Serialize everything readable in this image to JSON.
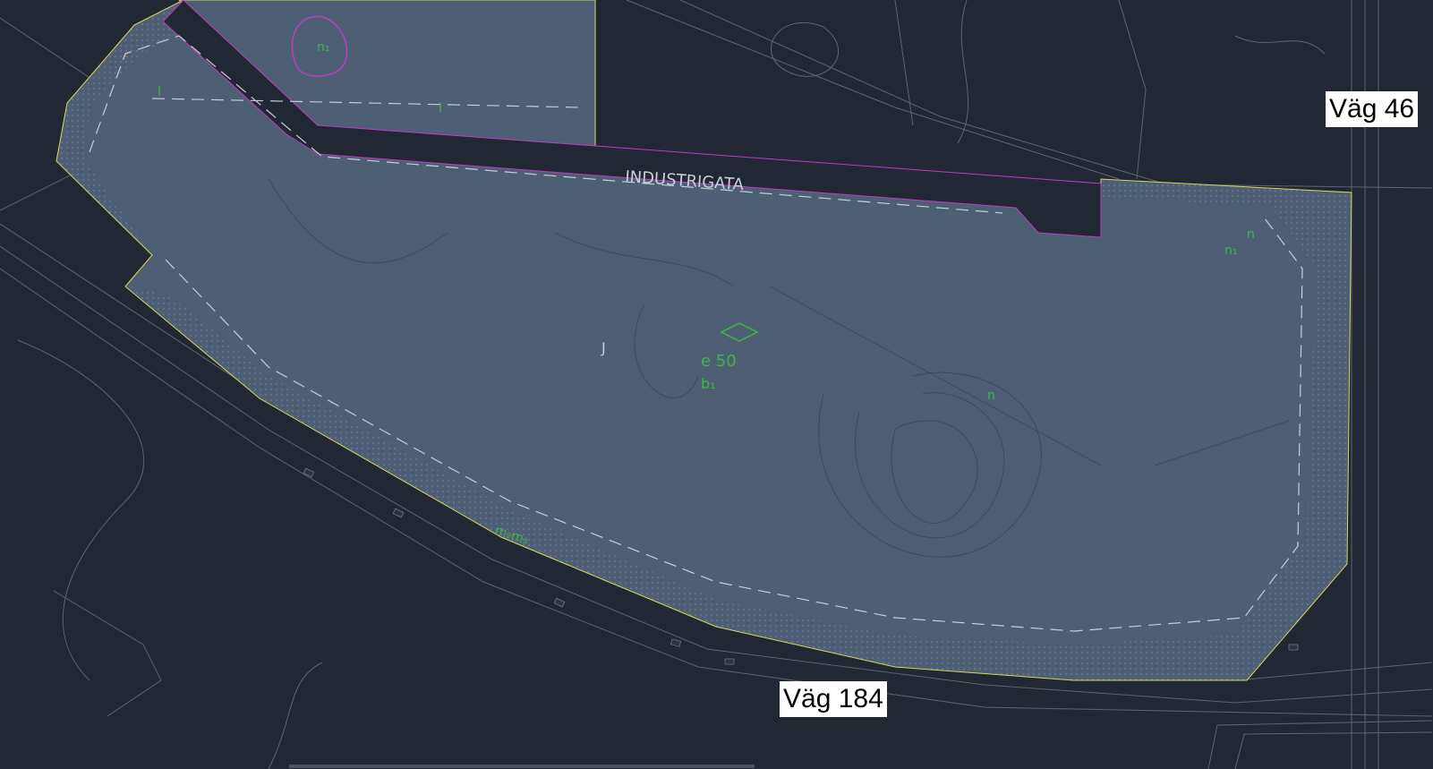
{
  "map": {
    "street_label": "INDUSTRIGATA",
    "zone_letter": "J",
    "annotations": {
      "height": "e 50",
      "building_mark": "b₁",
      "plan_mark_top": "n₁",
      "plan_mark_right_1": "n",
      "plan_mark_right_2": "n₁",
      "plan_mark_center": "n",
      "plan_mark_left_1": "I",
      "plan_mark_left_2": "I",
      "bottom_mark": "m₂m₃"
    },
    "roads": {
      "north_east": "Väg 46",
      "south": "Väg 184"
    },
    "colors": {
      "background": "#212834",
      "plan_area": "#4e5f75",
      "plan_border": "#d8d85a",
      "road_boundary": "#c03cc0",
      "annotation_green": "#3fb53f",
      "linework": "#6d7480"
    }
  }
}
